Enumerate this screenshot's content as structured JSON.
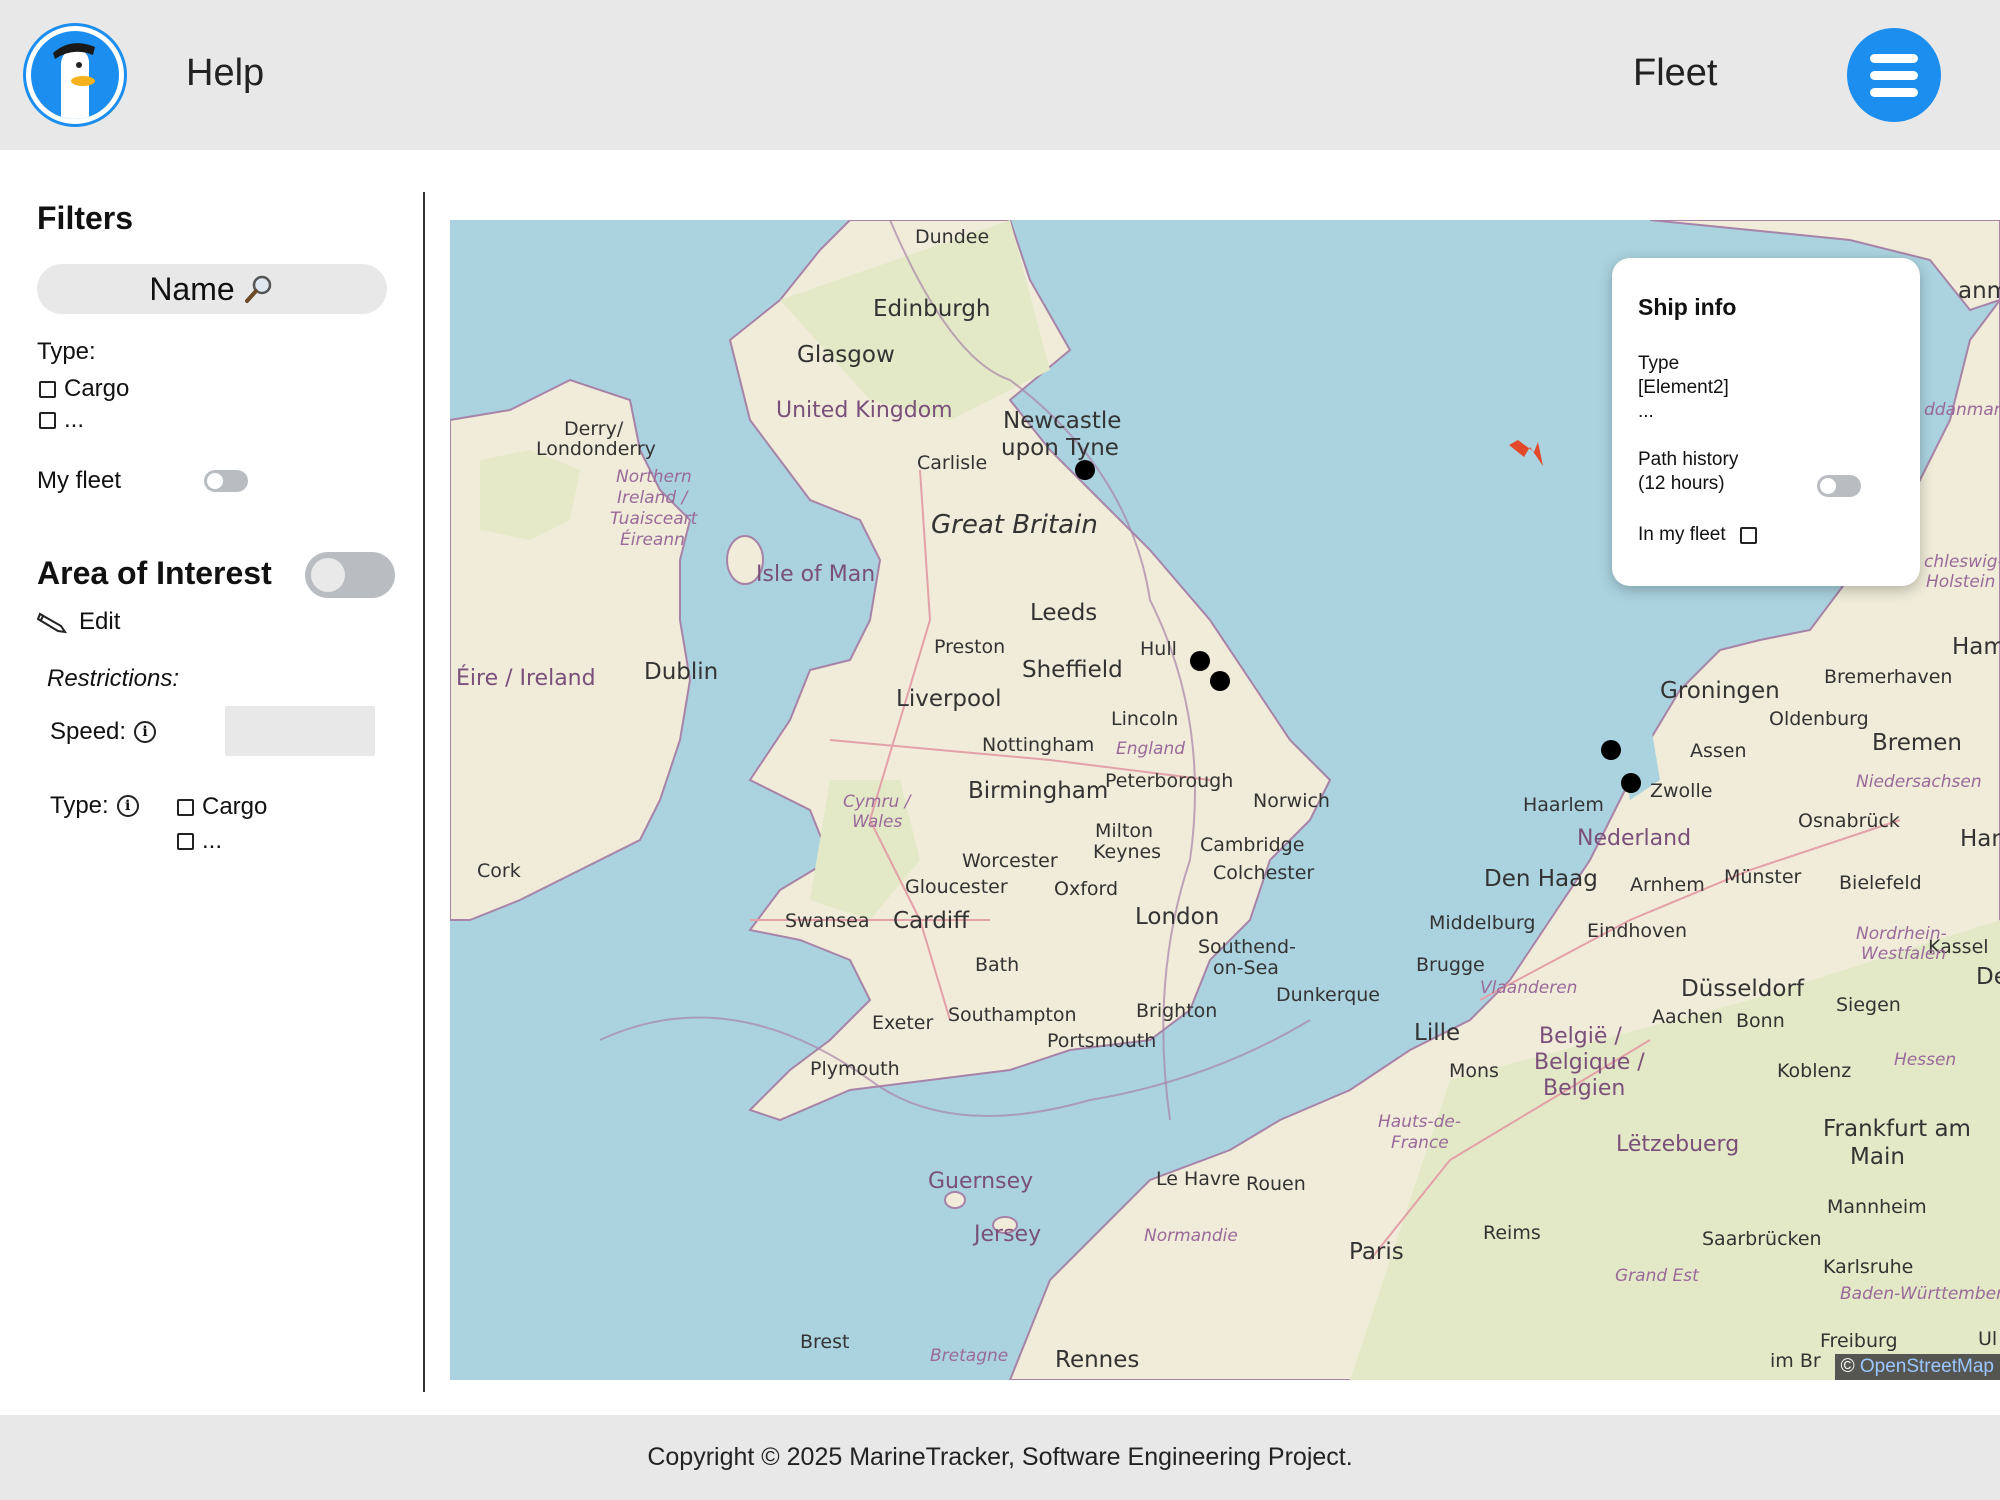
{
  "header": {
    "help_label": "Help",
    "fleet_label": "Fleet",
    "accent_color": "#1b8ef0"
  },
  "sidebar": {
    "filters_title": "Filters",
    "name_search_label": "Name",
    "name_search_icon": "magnifier-icon",
    "type_label": "Type:",
    "type_options": [
      "Cargo",
      "..."
    ],
    "my_fleet_label": "My fleet",
    "area_of_interest_title": "Area of Interest",
    "edit_label": "Edit",
    "edit_icon": "pencil-icon",
    "restrictions_label": "Restrictions:",
    "speed_label": "Speed:",
    "speed_value": "",
    "restriction_type_label": "Type:",
    "restriction_type_options": [
      "Cargo",
      "..."
    ]
  },
  "map": {
    "attribution_prefix": "©",
    "attribution_link": "OpenStreetMap",
    "labels": {
      "dundee": "Dundee",
      "edinburgh": "Edinburgh",
      "glasgow": "Glasgow",
      "uk": "United Kingdom",
      "newcastle1": "Newcastle",
      "newcastle2": "upon Tyne",
      "carlisle": "Carlisle",
      "great_britain": "Great Britain",
      "derry1": "Derry/",
      "derry2": "Londonderry",
      "ni1": "Northern",
      "ni2": "Ireland /",
      "ni3": "Tuaisceart",
      "ni4": "Éireann",
      "isle_of_man": "Isle of Man",
      "leeds": "Leeds",
      "hull": "Hull",
      "preston": "Preston",
      "sheffield": "Sheffield",
      "liverpool": "Liverpool",
      "eire": "Éire / Ireland",
      "dublin": "Dublin",
      "lincoln": "Lincoln",
      "nottingham": "Nottingham",
      "england": "England",
      "birmingham": "Birmingham",
      "peterborough": "Peterborough",
      "norwich": "Norwich",
      "cymru1": "Cymru /",
      "cymru2": "Wales",
      "worcester": "Worcester",
      "milton1": "Milton",
      "milton2": "Keynes",
      "cambridge": "Cambridge",
      "colchester": "Colchester",
      "cork": "Cork",
      "gloucester": "Gloucester",
      "oxford": "Oxford",
      "london": "London",
      "swansea": "Swansea",
      "cardiff": "Cardiff",
      "southend1": "Southend-",
      "southend2": "on-Sea",
      "bath": "Bath",
      "dunkerque": "Dunkerque",
      "exeter": "Exeter",
      "southampton": "Southampton",
      "brighton": "Brighton",
      "portsmouth": "Portsmouth",
      "plymouth": "Plymouth",
      "guernsey": "Guernsey",
      "jersey": "Jersey",
      "le_havre": "Le Havre",
      "rouen": "Rouen",
      "normandie": "Normandie",
      "paris": "Paris",
      "reims": "Reims",
      "brest": "Brest",
      "bretagne": "Bretagne",
      "rennes": "Rennes",
      "hauts1": "Hauts-de-",
      "hauts2": "France",
      "grand_est": "Grand Est",
      "lille": "Lille",
      "mons": "Mons",
      "belgie1": "België /",
      "belgie2": "Belgique /",
      "belgie3": "Belgien",
      "brugge": "Brugge",
      "vlaanderen": "Vlaanderen",
      "middelburg": "Middelburg",
      "den_haag": "Den Haag",
      "nederland": "Nederland",
      "haarlem": "Haarlem",
      "zwolle": "Zwolle",
      "groningen": "Groningen",
      "assen": "Assen",
      "arnhem": "Arnhem",
      "eindhoven": "Eindhoven",
      "dusseldorf": "Düsseldorf",
      "aachen": "Aachen",
      "bonn": "Bonn",
      "koblenz": "Koblenz",
      "hessen": "Hessen",
      "letzebuerg": "Lëtzebuerg",
      "frankfurt1": "Frankfurt am",
      "frankfurt2": "Main",
      "mannheim": "Mannheim",
      "saarbrucken": "Saarbrücken",
      "karlsruhe": "Karlsruhe",
      "baden": "Baden-Württemberg",
      "freiburg1": "Freiburg",
      "freiburg2": "im Br",
      "siegen": "Siegen",
      "kassel": "Kassel",
      "nrw1": "Nordrhein-",
      "nrw2": "Westfalen",
      "bielefeld": "Bielefeld",
      "munster": "Münster",
      "osnabruck": "Osnabrück",
      "hannover": "Hannov",
      "niedersachsen": "Niedersachsen",
      "bremen": "Bremen",
      "oldenburg": "Oldenburg",
      "bremerhaven": "Bremerhaven",
      "hamb": "Hamb",
      "danmark": "anmark",
      "ddanmark": "ddanmark",
      "schleswig1": "chleswig-",
      "schleswig2": "Holstein",
      "de": "De",
      "ul": "Ul"
    }
  },
  "ship_info": {
    "title": "Ship info",
    "type_label": "Type",
    "type_value": "[Element2]",
    "type_more": "...",
    "path_history_label": "Path history",
    "path_history_sub": "(12 hours)",
    "in_my_fleet_label": "In my fleet"
  },
  "footer": {
    "copyright": "Copyright © 2025 MarineTracker, Software Engineering Project."
  }
}
